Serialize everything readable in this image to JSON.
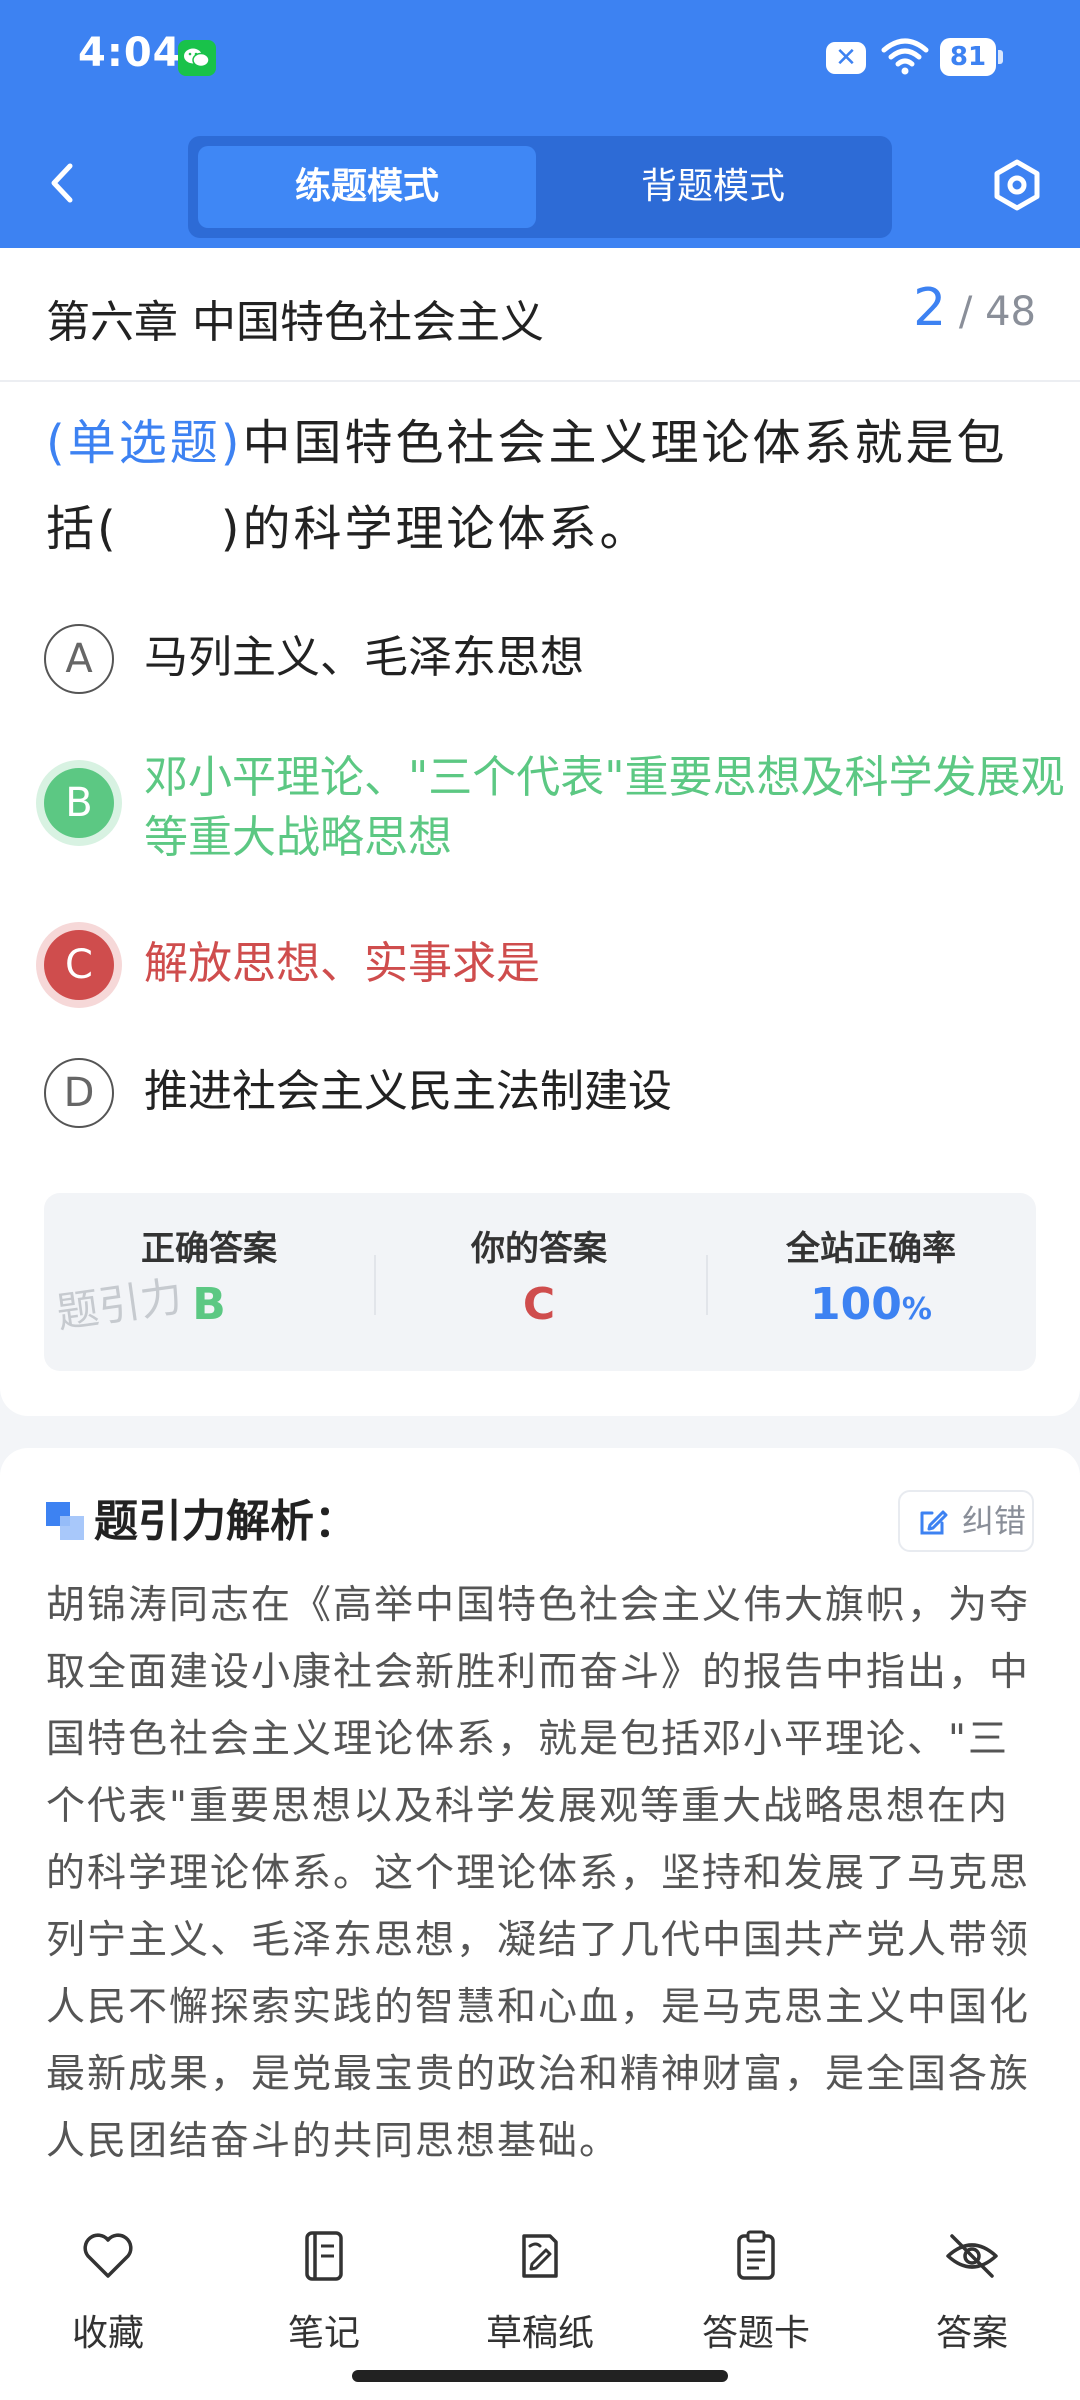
{
  "status": {
    "time": "4:04",
    "battery": "81",
    "sim_label": "✕"
  },
  "nav": {
    "tabs": [
      {
        "label": "练题模式",
        "active": true
      },
      {
        "label": "背题模式",
        "active": false
      }
    ]
  },
  "header": {
    "chapter": "第六章 中国特色社会主义",
    "current": "2",
    "separator": "/",
    "total": "48"
  },
  "question": {
    "type": "(单选题)",
    "text": "中国特色社会主义理论体系就是包括(　　)的科学理论体系。",
    "options": [
      {
        "letter": "A",
        "text": "马列主义、毛泽东思想",
        "state": "normal"
      },
      {
        "letter": "B",
        "text": "邓小平理论、\"三个代表\"重要思想及科学发展观等重大战略思想",
        "state": "correct"
      },
      {
        "letter": "C",
        "text": "解放思想、实事求是",
        "state": "wrong"
      },
      {
        "letter": "D",
        "text": "推进社会主义民主法制建设",
        "state": "normal"
      }
    ]
  },
  "answer_summary": {
    "correct_label": "正确答案",
    "correct_value": "B",
    "yours_label": "你的答案",
    "yours_value": "C",
    "rate_label": "全站正确率",
    "rate_value": "100",
    "rate_unit": "%",
    "watermark": "题引力"
  },
  "analysis": {
    "title": "题引力解析：",
    "correct_button": "纠错",
    "text": "胡锦涛同志在《高举中国特色社会主义伟大旗帜，为夺取全面建设小康社会新胜利而奋斗》的报告中指出，中国特色社会主义理论体系，就是包括邓小平理论、\"三个代表\"重要思想以及科学发展观等重大战略思想在内的科学理论体系。这个理论体系，坚持和发展了马克思列宁主义、毛泽东思想，凝结了几代中国共产党人带领人民不懈探索实践的智慧和心血，是马克思主义中国化最新成果，是党最宝贵的政治和精神财富，是全国各族人民团结奋斗的共同思想基础。"
  },
  "toolbar": {
    "items": [
      {
        "label": "收藏",
        "icon": "heart-icon"
      },
      {
        "label": "笔记",
        "icon": "notebook-icon"
      },
      {
        "label": "草稿纸",
        "icon": "draft-icon"
      },
      {
        "label": "答题卡",
        "icon": "clipboard-icon"
      },
      {
        "label": "答案",
        "icon": "eye-off-icon"
      }
    ]
  },
  "colors": {
    "primary": "#3d82f2",
    "correct": "#5cc883",
    "wrong": "#cf4d4d"
  }
}
